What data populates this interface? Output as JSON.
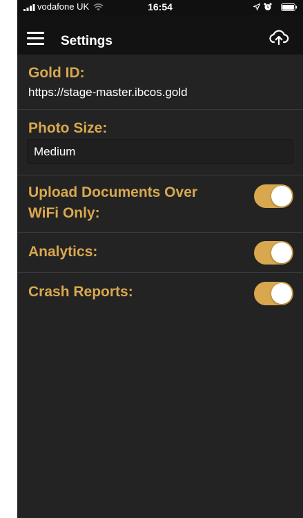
{
  "status_bar": {
    "carrier": "vodafone UK",
    "time": "16:54"
  },
  "nav": {
    "title": "Settings",
    "menu_icon": "hamburger-menu-icon",
    "action_icon": "cloud-upload-icon"
  },
  "settings": {
    "gold_id": {
      "label": "Gold ID:",
      "value": "https://stage-master.ibcos.gold"
    },
    "photo_size": {
      "label": "Photo Size:",
      "value": "Medium"
    },
    "upload_wifi_only": {
      "label_line1": "Upload Documents Over",
      "label_line2": "WiFi Only:",
      "enabled": true
    },
    "analytics": {
      "label": "Analytics:",
      "enabled": true
    },
    "crash_reports": {
      "label": "Crash Reports:",
      "enabled": true
    }
  },
  "colors": {
    "accent": "#d9a84e",
    "background": "#232323",
    "nav_background": "#121212"
  }
}
